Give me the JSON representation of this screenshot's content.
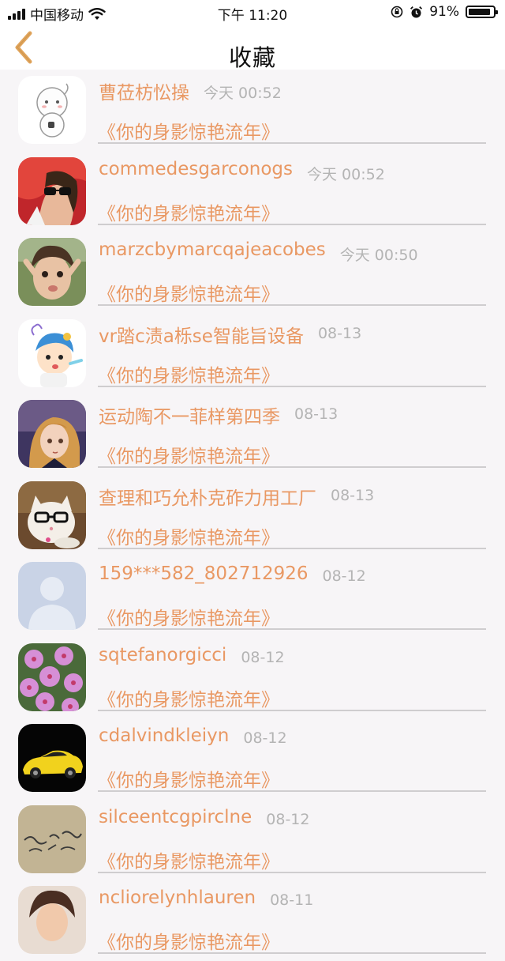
{
  "status_bar": {
    "carrier": "中国移动",
    "time": "下午 11:20",
    "battery": "91%",
    "battery_level": 0.91,
    "icons": [
      "signal-icon",
      "wifi-icon",
      "orientation-lock-icon",
      "alarm-icon",
      "battery-icon"
    ]
  },
  "nav": {
    "title": "收藏",
    "back_icon": "chevron-left-icon",
    "accent": "#e0a45c"
  },
  "colors": {
    "name": "#e99863",
    "time": "#b4b4b4"
  },
  "favorites": [
    {
      "name": "曹莅枋忪操",
      "time": "今天 00:52",
      "work": "《你的身影惊艳流年》"
    },
    {
      "name": "commedesgarconogs",
      "time": "今天 00:52",
      "work": "《你的身影惊艳流年》"
    },
    {
      "name": "marzcbymarcqajeacobes",
      "time": "今天 00:50",
      "work": "《你的身影惊艳流年》"
    },
    {
      "name": "vr踏c渍a栎se智能旨设备",
      "time": "08-13",
      "work": "《你的身影惊艳流年》"
    },
    {
      "name": "运动陶不一菲样第四季",
      "time": "08-13",
      "work": "《你的身影惊艳流年》"
    },
    {
      "name": "查理和巧允朴克砟力用工厂",
      "time": "08-13",
      "work": "《你的身影惊艳流年》"
    },
    {
      "name": "159***582_802712926",
      "time": "08-12",
      "work": "《你的身影惊艳流年》"
    },
    {
      "name": "sqtefanorgicci",
      "time": "08-12",
      "work": "《你的身影惊艳流年》"
    },
    {
      "name": "cdalvindkleiyn",
      "time": "08-12",
      "work": "《你的身影惊艳流年》"
    },
    {
      "name": "silceentcgpirclne",
      "time": "08-12",
      "work": "《你的身影惊艳流年》"
    },
    {
      "name": "ncliorelynhlauren",
      "time": "08-11",
      "work": "《你的身影惊艳流年》"
    }
  ]
}
